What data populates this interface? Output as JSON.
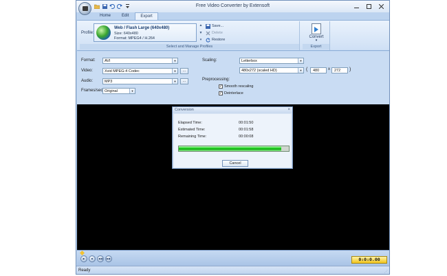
{
  "window": {
    "title": "Free Video Converter by Extensoft",
    "minimize_icon": "minimize-icon",
    "maximize_icon": "maximize-icon",
    "close_icon": "close-icon"
  },
  "quick_access": {
    "items": [
      "open-folder-icon",
      "save-icon",
      "undo-icon",
      "redo-icon",
      "customize-icon"
    ]
  },
  "tabs": [
    {
      "label": "Home",
      "active": false
    },
    {
      "label": "Edit",
      "active": false
    },
    {
      "label": "Export",
      "active": true
    }
  ],
  "ribbon": {
    "profile_label": "Profile:",
    "profile": {
      "name": "Web / Flash Large (640x480)",
      "size": "Size: 640x480",
      "format": "Format: MPEG4 / H.264"
    },
    "actions": {
      "save": "Save...",
      "delete": "Delete",
      "restore": "Restore"
    },
    "profiles_group_label": "Select and Manage Profiles",
    "convert_label": "Convert",
    "export_group_label": "Export"
  },
  "settings": {
    "format_label": "Format:",
    "format_value": "AVI",
    "video_label": "Video:",
    "video_value": "Xvid MPEG-4 Codec",
    "audio_label": "Audio:",
    "audio_value": "MP3",
    "fps_label": "Frames/sec:",
    "fps_value": "Original",
    "ellipsis": "...",
    "scaling_label": "Scaling:",
    "scaling_value": "Letterbox",
    "resolution_value": "480x272 (scaled HD)",
    "width_value": "480",
    "height_value": "272",
    "paren_open": "(",
    "times": "x",
    "paren_close": ")",
    "preprocessing_label": "Preprocessing:",
    "smooth_label": "Smooth rescaling",
    "smooth_checked": true,
    "deinterlace_label": "Deinterlace",
    "deinterlace_checked": true
  },
  "dialog": {
    "title": "Conversion",
    "elapsed_label": "Elapsed Time:",
    "elapsed_value": "00:01:50",
    "estimated_label": "Estimated Time:",
    "estimated_value": "00:01:58",
    "remaining_label": "Remaining Time:",
    "remaining_value": "00:00:08",
    "progress_fraction": 0.93,
    "cancel_label": "Cancel"
  },
  "player": {
    "timecode": "0:0:0.00",
    "controls": [
      "play-icon",
      "stop-icon",
      "rewind-icon",
      "fast-forward-icon"
    ]
  },
  "status": {
    "text": "Ready"
  },
  "colors": {
    "progress_green": "#18d418",
    "timecode_bg": "#f2c51c",
    "app_bg": "#bcd3ef"
  }
}
